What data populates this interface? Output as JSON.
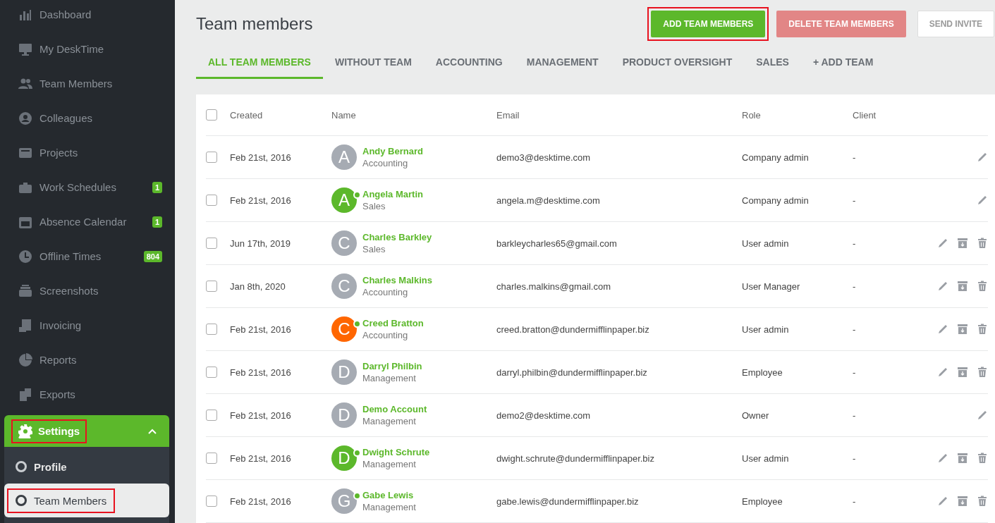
{
  "sidebar": {
    "items": [
      {
        "label": "Dashboard"
      },
      {
        "label": "My DeskTime"
      },
      {
        "label": "Team Members"
      },
      {
        "label": "Colleagues"
      },
      {
        "label": "Projects"
      },
      {
        "label": "Work Schedules",
        "badge": "1"
      },
      {
        "label": "Absence Calendar",
        "badge": "1"
      },
      {
        "label": "Offline Times",
        "badge": "804"
      },
      {
        "label": "Screenshots"
      },
      {
        "label": "Invoicing"
      },
      {
        "label": "Reports"
      },
      {
        "label": "Exports"
      }
    ],
    "settings": {
      "label": "Settings",
      "expanded": true,
      "highlighted": true,
      "children": [
        {
          "label": "Profile",
          "selected": false,
          "highlighted": false
        },
        {
          "label": "Team Members",
          "selected": true,
          "highlighted": true
        }
      ]
    }
  },
  "page": {
    "title": "Team members",
    "buttons": [
      {
        "label": "ADD TEAM MEMBERS",
        "kind": "primary",
        "highlighted": true
      },
      {
        "label": "DELETE TEAM MEMBERS",
        "kind": "danger",
        "highlighted": false
      },
      {
        "label": "SEND INVITE",
        "kind": "plain",
        "highlighted": false
      }
    ],
    "tabs": [
      {
        "label": "ALL TEAM MEMBERS",
        "selected": true
      },
      {
        "label": "WITHOUT TEAM",
        "selected": false
      },
      {
        "label": "ACCOUNTING",
        "selected": false
      },
      {
        "label": "MANAGEMENT",
        "selected": false
      },
      {
        "label": "PRODUCT OVERSIGHT",
        "selected": false
      },
      {
        "label": "SALES",
        "selected": false
      },
      {
        "label": "+ ADD TEAM",
        "selected": false
      }
    ]
  },
  "table": {
    "all_checked": false,
    "columns": [
      "Created",
      "Name",
      "Email",
      "Role",
      "Client"
    ],
    "rows": [
      {
        "checked": false,
        "created": "Feb 21st, 2016",
        "initial": "A",
        "color": "#a6abb3",
        "online": false,
        "name": "Andy Bernard",
        "team": "Accounting",
        "email": "demo3@desktime.com",
        "role": "Company admin",
        "client": "-",
        "removable": false
      },
      {
        "checked": false,
        "created": "Feb 21st, 2016",
        "initial": "A",
        "color": "#5cb82b",
        "online": true,
        "name": "Angela Martin",
        "team": "Sales",
        "email": "angela.m@desktime.com",
        "role": "Company admin",
        "client": "-",
        "removable": false
      },
      {
        "checked": false,
        "created": "Jun 17th, 2019",
        "initial": "C",
        "color": "#a6abb3",
        "online": false,
        "name": "Charles Barkley",
        "team": "Sales",
        "email": "barkleycharles65@gmail.com",
        "role": "User admin",
        "client": "-",
        "removable": true
      },
      {
        "checked": false,
        "created": "Jan 8th, 2020",
        "initial": "C",
        "color": "#a6abb3",
        "online": false,
        "name": "Charles Malkins",
        "team": "Accounting",
        "email": "charles.malkins@gmail.com",
        "role": "User Manager",
        "client": "-",
        "removable": true
      },
      {
        "checked": false,
        "created": "Feb 21st, 2016",
        "initial": "C",
        "color": "#ff6600",
        "online": true,
        "name": "Creed Bratton",
        "team": "Accounting",
        "email": "creed.bratton@dundermifflinpaper.biz",
        "role": "User admin",
        "client": "-",
        "removable": true
      },
      {
        "checked": false,
        "created": "Feb 21st, 2016",
        "initial": "D",
        "color": "#a6abb3",
        "online": false,
        "name": "Darryl Philbin",
        "team": "Management",
        "email": "darryl.philbin@dundermifflinpaper.biz",
        "role": "Employee",
        "client": "-",
        "removable": true
      },
      {
        "checked": false,
        "created": "Feb 21st, 2016",
        "initial": "D",
        "color": "#a6abb3",
        "online": false,
        "name": "Demo Account",
        "team": "Management",
        "email": "demo2@desktime.com",
        "role": "Owner",
        "client": "-",
        "removable": false
      },
      {
        "checked": false,
        "created": "Feb 21st, 2016",
        "initial": "D",
        "color": "#5cb82b",
        "online": true,
        "name": "Dwight Schrute",
        "team": "Management",
        "email": "dwight.schrute@dundermifflinpaper.biz",
        "role": "User admin",
        "client": "-",
        "removable": true
      },
      {
        "checked": false,
        "created": "Feb 21st, 2016",
        "initial": "G",
        "color": "#a6abb3",
        "online": true,
        "name": "Gabe Lewis",
        "team": "Management",
        "email": "gabe.lewis@dundermifflinpaper.biz",
        "role": "Employee",
        "client": "-",
        "removable": true
      }
    ]
  }
}
